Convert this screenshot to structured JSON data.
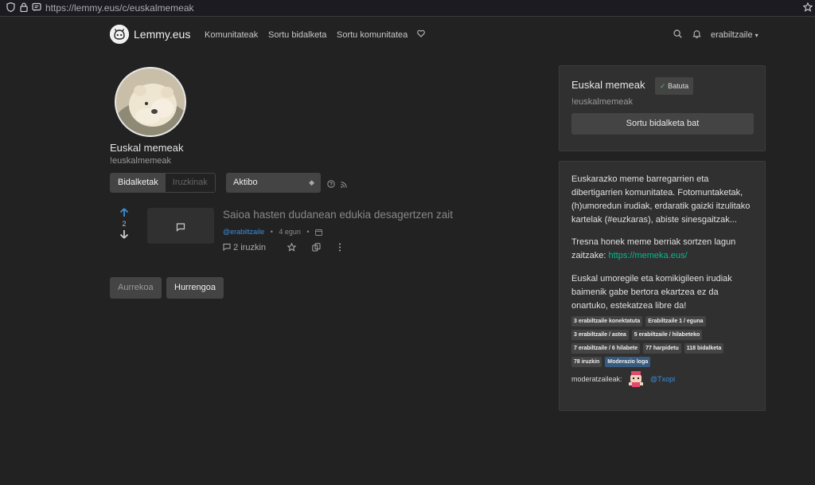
{
  "browser": {
    "url": "https://lemmy.eus/c/euskalmemeak"
  },
  "nav": {
    "brand": "Lemmy.eus",
    "links": [
      "Komunitateak",
      "Sortu bidalketa",
      "Sortu komunitatea"
    ],
    "user": "erabiltzaile"
  },
  "community": {
    "name": "Euskal memeak",
    "handle": "!euskalmemeak",
    "tabs": [
      "Bidalketak",
      "Iruzkinak"
    ],
    "sort": "Aktibo"
  },
  "post": {
    "title": "Saioa hasten dudanean edukia desagertzen zait",
    "score": "2",
    "author": "@erabiltzaile",
    "time": "4 egun",
    "comments": "2 iruzkin"
  },
  "pagination": {
    "prev": "Aurrekoa",
    "next": "Hurrengoa"
  },
  "sidebar": {
    "title": "Euskal memeak",
    "joined": "Batuta",
    "handle": "!euskalmemeak",
    "create_post": "Sortu bidalketa bat",
    "desc1": "Euskarazko meme barregarrien eta dibertigarrien komunitatea. Fotomuntaketak, (h)umoredun irudiak, erdaratik gaizki itzulitako kartelak (#euzkaras), abiste sinesgaitzak...",
    "desc2_text": "Tresna honek meme berriak sortzen lagun zaitzake: ",
    "desc2_link": "https://memeka.eus/",
    "desc3": "Euskal umoregile eta komikigileen irudiak baimenik gabe bertora ekartzea ez da onartuko, estekatzea libre da!",
    "stats": [
      "3 erabiltzaile konektatuta",
      "Erabiltzaile 1 / eguna",
      "3 erabiltzaile / astea",
      "5 erabiltzaile / hilabeteko",
      "7 erabiltzaile / 6 hilabete",
      "77 harpidetu",
      "118 bidalketa",
      "78 iruzkin",
      "Moderazio loga"
    ],
    "mods_label": "moderatzaileak:",
    "mod_name": "@Txopi"
  },
  "colors": {
    "bg": "#222222",
    "card": "#303030",
    "accent": "#00bc8c",
    "link": "#3b8fd8",
    "badge_blue": "#375a7f"
  }
}
